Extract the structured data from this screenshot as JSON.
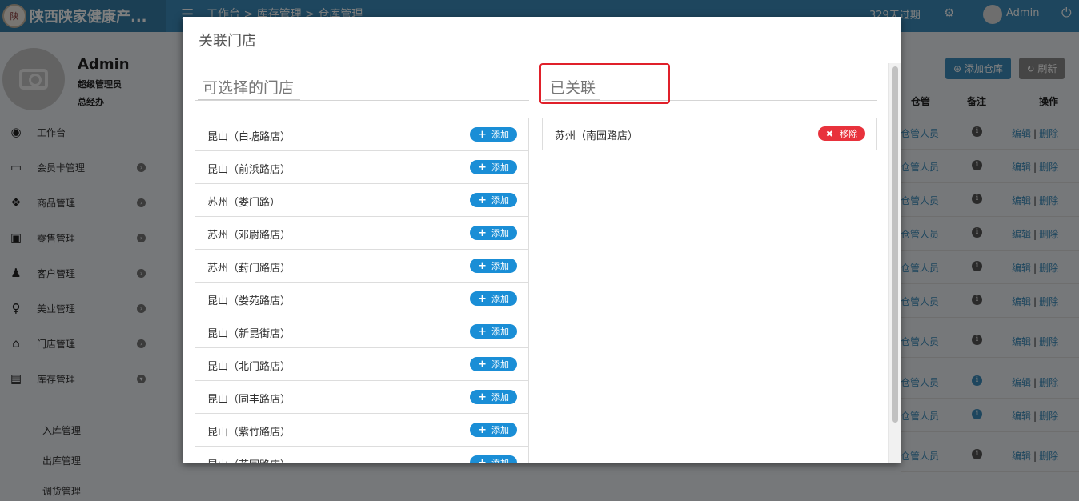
{
  "app": {
    "logo_glyph": "陕",
    "brand": "陕西陕家健康产...",
    "breadcrumb": "工作台 > 库存管理 > 仓库管理",
    "expire_text": "329天过期",
    "user": "Admin"
  },
  "sidebar": {
    "name": "Admin",
    "role": "超级管理员",
    "dept": "总经办",
    "items": [
      {
        "label": "工作台",
        "icon": "dashboard-icon",
        "glyph": "◉"
      },
      {
        "label": "会员卡管理",
        "icon": "card-icon",
        "glyph": "▭"
      },
      {
        "label": "商品管理",
        "icon": "cubes-icon",
        "glyph": "❖"
      },
      {
        "label": "零售管理",
        "icon": "money-icon",
        "glyph": "▣"
      },
      {
        "label": "客户管理",
        "icon": "male-icon",
        "glyph": "♟"
      },
      {
        "label": "美业管理",
        "icon": "female-icon",
        "glyph": "♀"
      },
      {
        "label": "门店管理",
        "icon": "home-icon",
        "glyph": "⌂"
      },
      {
        "label": "库存管理",
        "icon": "archive-icon",
        "glyph": "▤"
      }
    ],
    "sub_items": [
      "入库管理",
      "出库管理",
      "调货管理"
    ]
  },
  "page": {
    "add_warehouse": "添加仓库",
    "refresh": "刷新",
    "columns": [
      "仓管",
      "备注",
      "操作"
    ],
    "row_keeper": "仓管人员",
    "row_edit": "编辑",
    "row_delete": "删除",
    "row_sep": "|"
  },
  "modal": {
    "title": "关联门店",
    "available_title": "可选择的门店",
    "linked_title": "已关联",
    "add_label": "添加",
    "remove_label": "移除",
    "available": [
      "昆山（白塘路店）",
      "昆山（前浜路店）",
      "苏州（娄门路）",
      "苏州（邓尉路店）",
      "苏州（葑门路店）",
      "昆山（娄苑路店）",
      "昆山（新昆街店）",
      "昆山（北门路店）",
      "昆山（同丰路店）",
      "昆山（紫竹路店）",
      "昆山（花园路店）"
    ],
    "linked": [
      "苏州（南园路店）"
    ]
  }
}
